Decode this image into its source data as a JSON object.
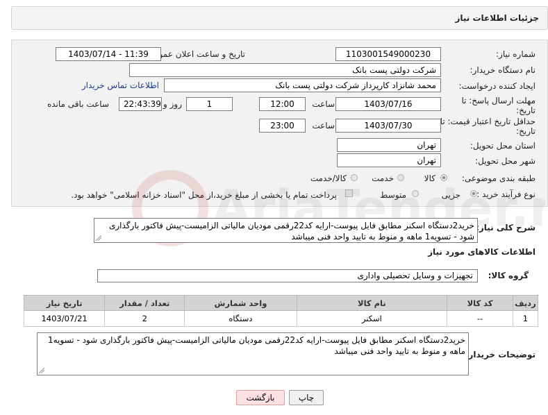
{
  "header": {
    "title": "جزئیات اطلاعات نیاز"
  },
  "form": {
    "need_number_label": "شماره نیاز:",
    "need_number": "1103001549000230",
    "announce_label": "تاریخ و ساعت اعلان عمومی:",
    "announce_value": "1403/07/14 - 11:39",
    "buyer_org_label": "نام دستگاه خریدار:",
    "buyer_org": "شرکت دولتی پست بانک",
    "creator_label": "ایجاد کننده درخواست:",
    "creator": "محمد شانزاد کارپرداز شرکت دولتی پست بانک",
    "contact_link": "اطلاعات تماس خریدار",
    "deadline_label_1": "مهلت ارسال پاسخ: تا",
    "deadline_label_2": "تاریخ:",
    "deadline_date": "1403/07/16",
    "time_label": "ساعت",
    "deadline_time": "12:00",
    "days_value": "1",
    "days_label": "روز و",
    "remaining_time": "22:43:39",
    "remaining_label": "ساعت باقی مانده",
    "validity_label_1": "حداقل تاریخ اعتبار قیمت: تا",
    "validity_label_2": "تاریخ:",
    "validity_date": "1403/07/30",
    "validity_time": "23:00",
    "province_label": "استان محل تحویل:",
    "province": "تهران",
    "city_label": "شهر محل تحویل:",
    "city": "تهران",
    "category_label": "طبقه بندی موضوعی:",
    "category_options": [
      "کالا",
      "خدمت",
      "کالا/خدمت"
    ],
    "category_selected": "کالا",
    "process_label": "نوع فرآیند خرید :",
    "process_options": [
      "جزیی",
      "متوسط"
    ],
    "process_selected": "جزیی",
    "payment_text": "پرداخت تمام یا بخشی از مبلغ خرید،از محل \"اسناد خزانه اسلامی\" خواهد بود."
  },
  "description": {
    "label": "شرح کلی نیاز:",
    "text": "خرید2دستگاه اسکنر مطابق فایل پیوست-ارایه کد22رقمی مودیان مالیاتی الزامیست-پیش فاکتور بارگذاری شود - تسویه1 ماهه و منوط به تایید  واحد فنی میباشد"
  },
  "goods_section": {
    "title": "اطلاعات کالاهای مورد نیاز",
    "group_label": "گروه کالا:",
    "group_value": "تجهیزات و وسایل تحصیلی واداری"
  },
  "table": {
    "headers": [
      "ردیف",
      "کد کالا",
      "نام کالا",
      "واحد شمارش",
      "تعداد / مقدار",
      "تاریخ نیاز"
    ],
    "rows": [
      [
        "1",
        "--",
        "اسکنر",
        "دستگاه",
        "2",
        "1403/07/21"
      ]
    ]
  },
  "buyer_notes": {
    "label": "توضیحات خریدار:",
    "text": "خرید2دستگاه اسکنر مطابق فایل پیوست-ارایه کد22رقمی مودیان مالیاتی الزامیست-پیش فاکتور بارگذاری شود - تسویه1 ماهه و منوط به تایید  واحد فنی میباشد"
  },
  "buttons": {
    "print": "چاپ",
    "back": "بازگشت"
  },
  "colors": {
    "link": "#1a3c8f",
    "back_button": "#fbe1e1",
    "table_header": "#d4d4d4"
  }
}
